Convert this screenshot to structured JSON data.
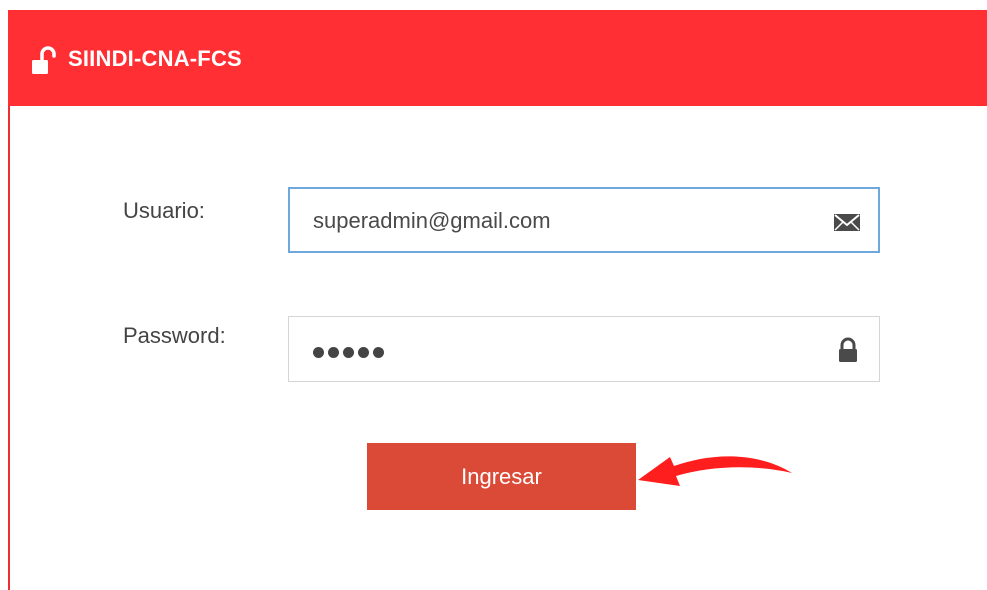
{
  "header": {
    "title": "SIINDI-CNA-FCS",
    "icon": "unlock-icon",
    "background": "#ff2f33"
  },
  "form": {
    "user_label": "Usuario:",
    "user_value": "superadmin@gmail.com",
    "user_icon": "envelope-icon",
    "password_label": "Password:",
    "password_masked": "•••••",
    "password_icon": "lock-icon",
    "submit_label": "Ingresar",
    "submit_color": "#db4a37"
  },
  "annotation": {
    "arrow_icon": "red-arrow-icon",
    "arrow_color": "#ff1e1e"
  }
}
